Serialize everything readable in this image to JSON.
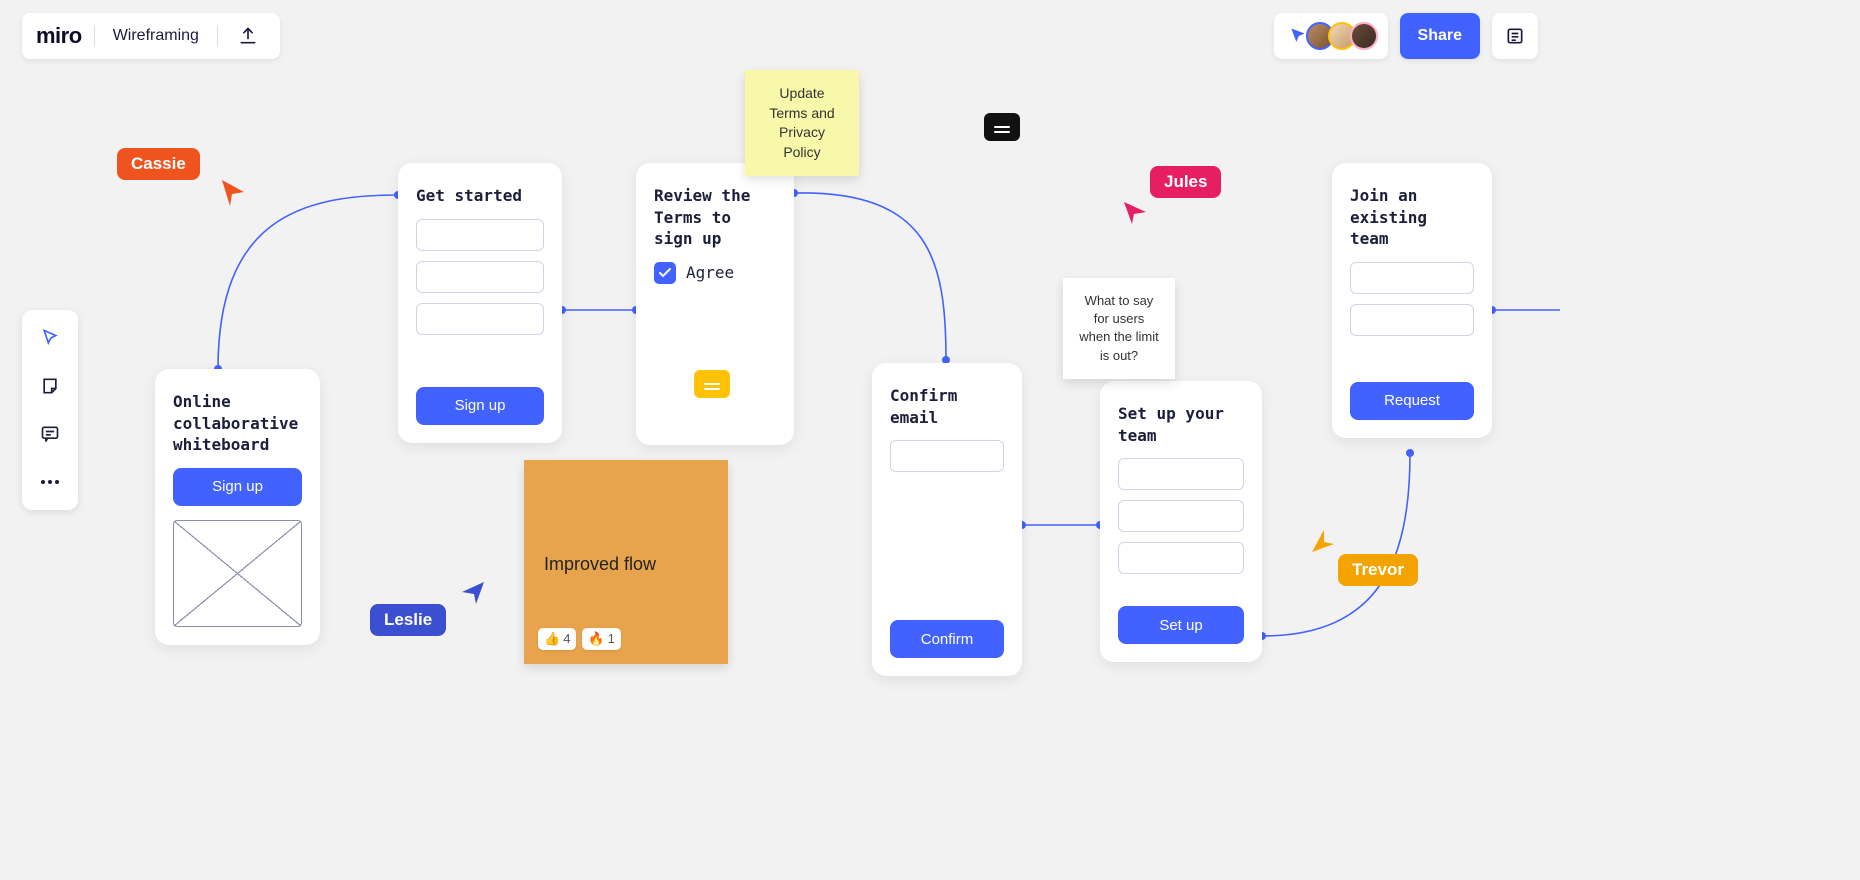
{
  "header": {
    "logo": "miro",
    "board_title": "Wireframing",
    "share_label": "Share"
  },
  "toolbar_icons": [
    "select",
    "sticky",
    "comment",
    "more"
  ],
  "cursors": {
    "cassie": {
      "name": "Cassie",
      "color": "#f0541e"
    },
    "leslie": {
      "name": "Leslie",
      "color": "#3b4fd1"
    },
    "jules": {
      "name": "Jules",
      "color": "#e61e62"
    },
    "trevor": {
      "name": "Trevor",
      "color": "#f5a300"
    }
  },
  "cards": {
    "online": {
      "title": "Online collaborative whiteboard",
      "button": "Sign up"
    },
    "get_started": {
      "title": "Get started",
      "button": "Sign up"
    },
    "review": {
      "title": "Review the Terms to sign up",
      "agree": "Agree"
    },
    "confirm": {
      "title": "Confirm email",
      "button": "Confirm"
    },
    "setup": {
      "title": "Set up your team",
      "button": "Set up"
    },
    "join": {
      "title": "Join an existing team",
      "button": "Request"
    }
  },
  "stickies": {
    "terms": "Update Terms and Privacy Policy",
    "limit": "What to say for users when the limit is out?",
    "improved": {
      "text": "Improved flow",
      "reactions": [
        {
          "emoji": "👍",
          "count": 4
        },
        {
          "emoji": "🔥",
          "count": 1
        }
      ]
    }
  }
}
